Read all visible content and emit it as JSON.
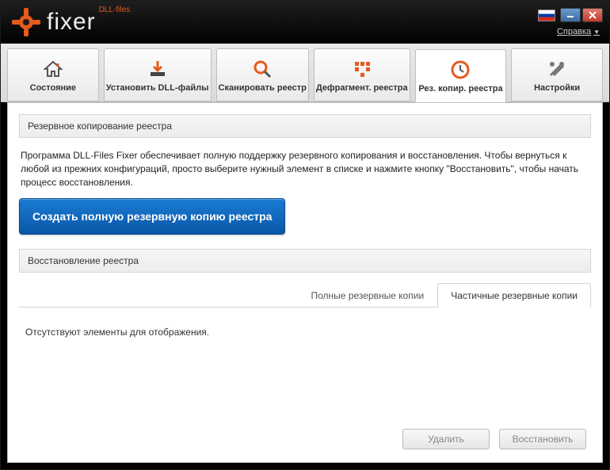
{
  "brand": {
    "name": "fixer",
    "super": "DLL-files"
  },
  "menu": {
    "help": "Справка"
  },
  "tabs": [
    {
      "id": "status",
      "label": "Состояние"
    },
    {
      "id": "install",
      "label": "Установить DLL-файлы"
    },
    {
      "id": "scan",
      "label": "Сканировать реестр"
    },
    {
      "id": "defrag",
      "label": "Дефрагмент. реестра"
    },
    {
      "id": "backup",
      "label": "Рез. копир. реестра"
    },
    {
      "id": "settings",
      "label": "Настройки"
    }
  ],
  "active_tab": "backup",
  "backup": {
    "section1_title": "Резервное копирование реестра",
    "description": "Программа DLL-Files Fixer обеспечивает полную поддержку резервного копирования и восстановления. Чтобы вернуться к любой из прежних конфигураций, просто выберите нужный элемент в списке и нажмите кнопку \"Восстановить\", чтобы начать процесс восстановления.",
    "create_btn": "Создать полную резервную копию реестра",
    "section2_title": "Восстановление реестра",
    "subtabs": {
      "full": "Полные резервные копии",
      "partial": "Частичные резервные копии"
    },
    "active_subtab": "partial",
    "empty_text": "Отсутствуют элементы для отображения.",
    "footer": {
      "delete": "Удалить",
      "restore": "Восстановить"
    }
  }
}
